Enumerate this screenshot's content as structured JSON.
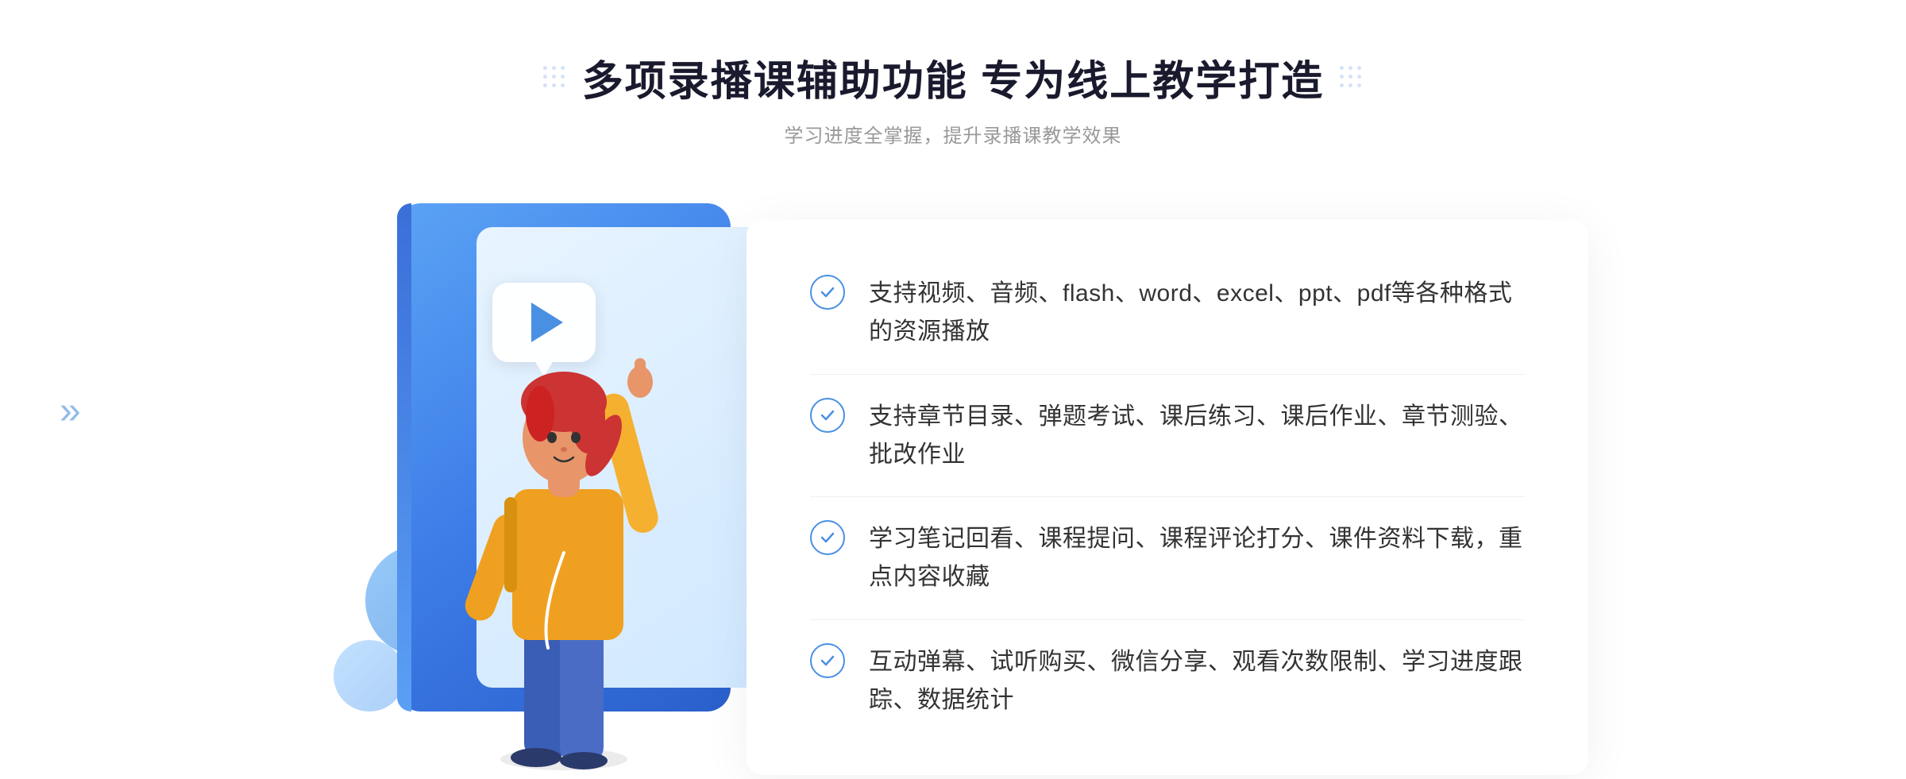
{
  "page": {
    "background": "#ffffff"
  },
  "header": {
    "main_title": "多项录播课辅助功能 专为线上教学打造",
    "subtitle": "学习进度全掌握，提升录播课教学效果"
  },
  "features": [
    {
      "id": 1,
      "text": "支持视频、音频、flash、word、excel、ppt、pdf等各种格式的资源播放"
    },
    {
      "id": 2,
      "text": "支持章节目录、弹题考试、课后练习、课后作业、章节测验、批改作业"
    },
    {
      "id": 3,
      "text": "学习笔记回看、课程提问、课程评论打分、课件资料下载，重点内容收藏"
    },
    {
      "id": 4,
      "text": "互动弹幕、试听购买、微信分享、观看次数限制、学习进度跟踪、数据统计"
    }
  ],
  "decorative": {
    "chevron_left": "»",
    "play_button_label": "play"
  }
}
